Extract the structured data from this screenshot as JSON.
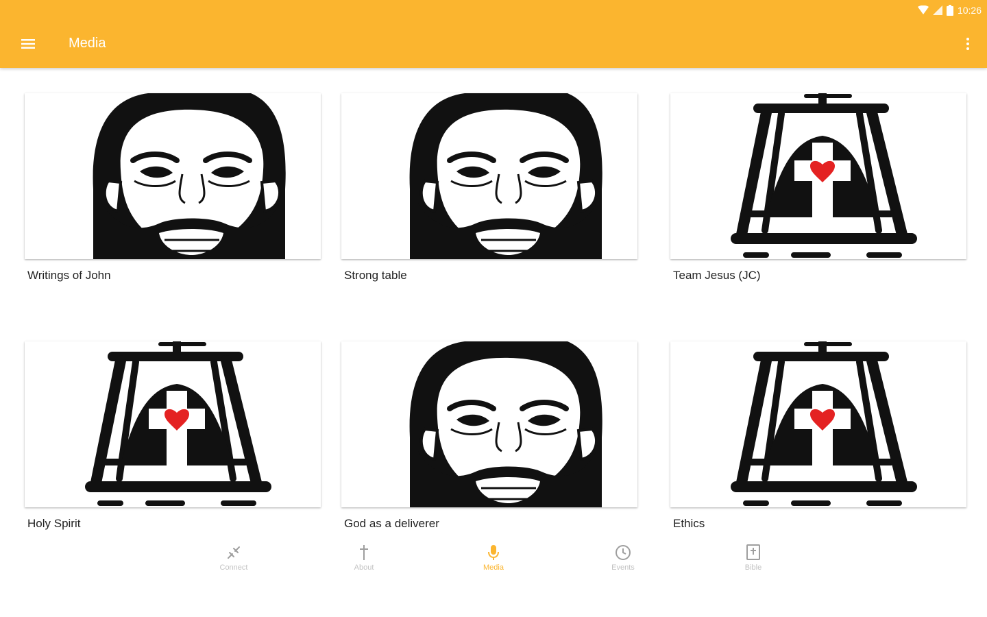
{
  "status_bar": {
    "time": "10:26"
  },
  "app_bar": {
    "title": "Media"
  },
  "colors": {
    "accent": "#FBB52F",
    "heart": "#E42222",
    "nav_inactive": "#C2C2C2"
  },
  "media_items": [
    {
      "title": "Writings of John",
      "image": "jesus-face"
    },
    {
      "title": "Strong table",
      "image": "jesus-face"
    },
    {
      "title": "Team Jesus (JC)",
      "image": "cross-heart"
    },
    {
      "title": "Holy Spirit",
      "image": "cross-heart"
    },
    {
      "title": "God as a deliverer",
      "image": "jesus-face"
    },
    {
      "title": "Ethics",
      "image": "cross-heart"
    }
  ],
  "bottom_nav": {
    "items": [
      {
        "label": "Connect",
        "icon": "connect-icon",
        "active": false
      },
      {
        "label": "About",
        "icon": "cross-icon",
        "active": false
      },
      {
        "label": "Media",
        "icon": "microphone-icon",
        "active": true
      },
      {
        "label": "Events",
        "icon": "clock-icon",
        "active": false
      },
      {
        "label": "Bible",
        "icon": "bible-icon",
        "active": false
      }
    ]
  }
}
